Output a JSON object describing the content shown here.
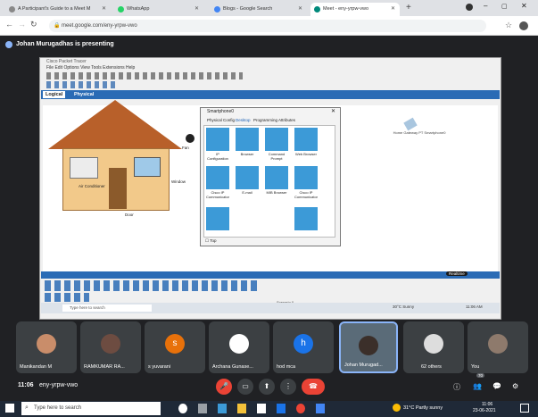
{
  "browser": {
    "tabs": [
      {
        "label": "A Participant's Guide to a Meet M"
      },
      {
        "label": "WhatsApp"
      },
      {
        "label": "Blogs - Google Search"
      },
      {
        "label": "Meet - eny-yrpw-vwo"
      }
    ],
    "url": "meet.google.com/eny-yrpw-vwo"
  },
  "meet": {
    "presenting_banner": "Johan Murugadhas is presenting",
    "meeting_code": "eny-yrpw-vwo",
    "time": "11:06",
    "participants": [
      {
        "name": "Manikandan M"
      },
      {
        "name": "RAMKUMAR RA..."
      },
      {
        "name": "s yuvarani",
        "initial": "s",
        "color": "#e8710a"
      },
      {
        "name": "Archana Gunase..."
      },
      {
        "name": "hod mca",
        "initial": "h",
        "color": "#1a73e8"
      },
      {
        "name": "Johan Murugad..."
      },
      {
        "name": "62 others"
      },
      {
        "name": "You"
      }
    ],
    "people_count": "70"
  },
  "packet_tracer": {
    "title": "Cisco Packet Tracer",
    "menu": "File  Edit  Options  View  Tools  Extensions  Help",
    "logical_tab": "Logical",
    "physical_tab": "Physical",
    "dialog_title": "Smartphone0",
    "dialog_tabs": [
      "Physical",
      "Config",
      "Desktop",
      "Programming",
      "Attributes"
    ],
    "apps": [
      "IP Configuration",
      "Browser",
      "Command Prompt",
      "Web Browser",
      "Cisco IP Communicator",
      "E-mail",
      "MIB Browser",
      "Cisco IP Communicator",
      "Text Editor",
      "Bluetooth"
    ],
    "top_label": "Top",
    "realtime": "Realtime",
    "pdu_label": "Scenario 0",
    "home_labels": [
      "Air Conditioner",
      "Window",
      "Fan",
      "Door"
    ],
    "device_label": "Home Gateway PT Smartphone0"
  },
  "inner_taskbar": {
    "search": "Type here to search",
    "weather": "30°C Sunny",
    "time": "11:06 AM"
  },
  "taskbar": {
    "search": "Type here to search",
    "weather": "31°C  Partly sunny",
    "time": "11:06",
    "date": "23-06-2021"
  },
  "colors": {
    "meet_bg": "#202124",
    "red_btn": "#ea4335",
    "pt_blue": "#2a6bb5"
  }
}
